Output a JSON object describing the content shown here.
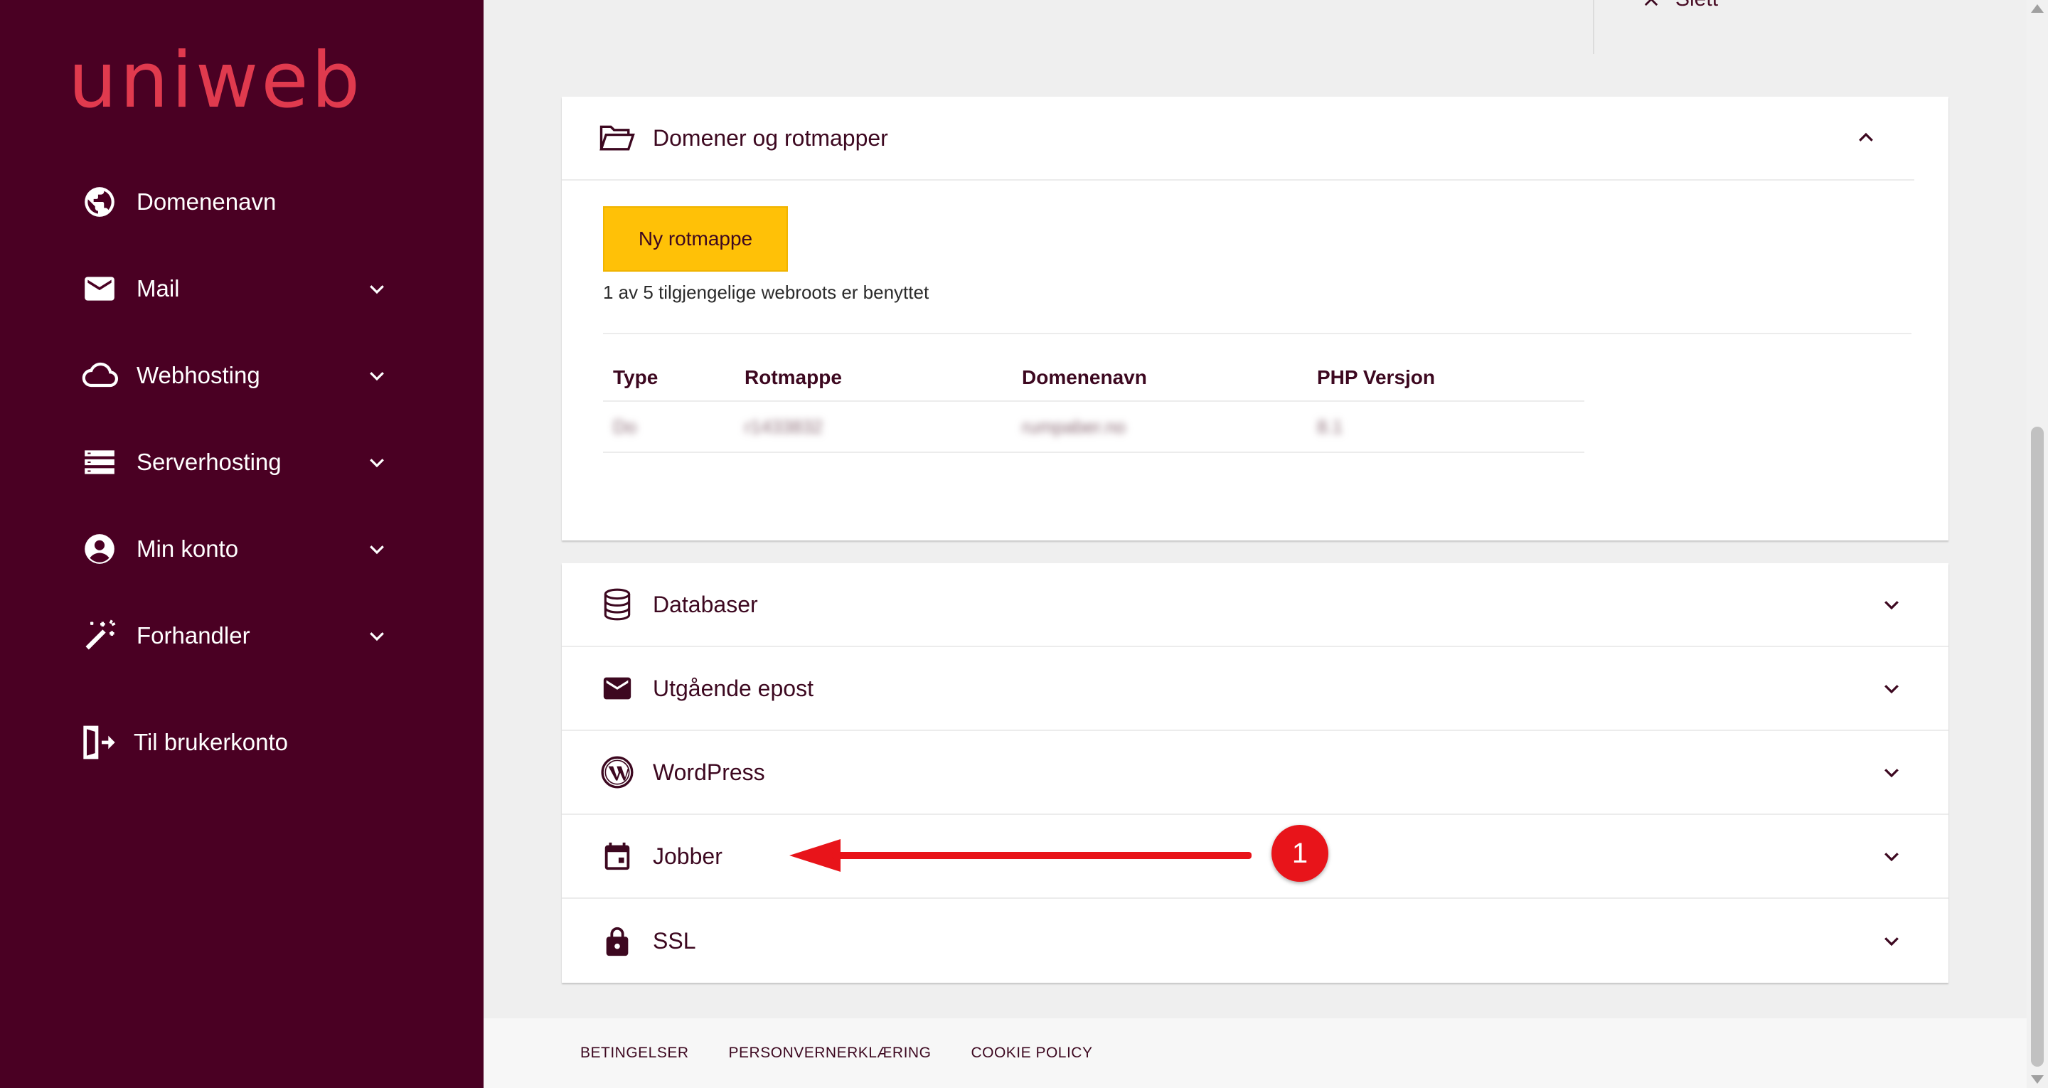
{
  "brand": {
    "logo_text": "uniweb",
    "logo_color": "#e03a4e",
    "sidebar_bg": "#4a0023"
  },
  "sidebar": {
    "items": [
      {
        "label": "Domenenavn",
        "icon": "globe-icon",
        "has_chevron": false
      },
      {
        "label": "Mail",
        "icon": "mail-icon",
        "has_chevron": true
      },
      {
        "label": "Webhosting",
        "icon": "cloud-icon",
        "has_chevron": true
      },
      {
        "label": "Serverhosting",
        "icon": "server-icon",
        "has_chevron": true
      },
      {
        "label": "Min konto",
        "icon": "account-icon",
        "has_chevron": true
      },
      {
        "label": "Forhandler",
        "icon": "magic-wand-icon",
        "has_chevron": true
      }
    ],
    "exit_label": "Til brukerkonto"
  },
  "topbar": {
    "close_label": "Slett"
  },
  "domains_card": {
    "title": "Domener og rotmapper",
    "new_button": "Ny rotmappe",
    "note": "1 av 5 tilgjengelige webroots er benyttet",
    "columns": [
      "Type",
      "Rotmappe",
      "Domenenavn",
      "PHP Versjon"
    ],
    "rows": [
      [
        "Do",
        "r1433832",
        "rumpaber.no",
        "8.1"
      ]
    ]
  },
  "accordion": [
    {
      "label": "Databaser",
      "icon": "database-icon"
    },
    {
      "label": "Utgående epost",
      "icon": "mail-icon"
    },
    {
      "label": "WordPress",
      "icon": "wordpress-icon"
    },
    {
      "label": "Jobber",
      "icon": "calendar-icon"
    },
    {
      "label": "SSL",
      "icon": "lock-icon"
    }
  ],
  "annotation": {
    "badge": "1",
    "color": "#e8141a"
  },
  "footer": {
    "links": [
      "BETINGELSER",
      "PERSONVERNERKLÆRING",
      "COOKIE POLICY"
    ]
  },
  "colors": {
    "accent": "#ffc107",
    "text": "#3d0820"
  }
}
